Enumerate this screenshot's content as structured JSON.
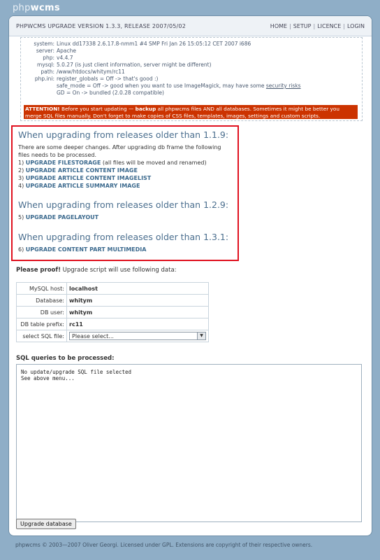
{
  "logo": {
    "light": "php",
    "bold": "wcms"
  },
  "header": {
    "title": "PHPWCMS UPGRADE VERSION 1.3.3, RELEASE 2007/05/02",
    "nav": [
      "HOME",
      "SETUP",
      "LICENCE",
      "LOGIN"
    ],
    "nav_separator": "|"
  },
  "system": {
    "rows": [
      {
        "key": "system:",
        "value": "Linux dd17338 2.6.17.8-nmm1 #4 SMP Fri Jan 26 15:05:12 CET 2007 i686"
      },
      {
        "key": "server:",
        "value": "Apache"
      },
      {
        "key": "php:",
        "value": "v4.4.7"
      },
      {
        "key": "mysql:",
        "value": "5.0.27 (is just client information, server might be different)"
      },
      {
        "key": "path:",
        "value": "/www/htdocs/whitym/rc11"
      },
      {
        "key": "php.ini:",
        "value": "register_globals = Off -> that's good :)"
      }
    ],
    "safe_mode_pre": "safe_mode = Off -> good when you want to use ImageMagick, may have some",
    "safe_mode_link": "security risks",
    "gd": "GD = On -> bundled (2.0.28 compatible)"
  },
  "attention": {
    "label": "ATTENTION!",
    "text1": " Before you start updating — ",
    "bold1": "backup",
    "text2": " all phpwcms files AND all databases. Sometimes it might be better you merge SQL files manually. Don't forget to make copies of CSS files, templates, images, settings and custom scripts."
  },
  "upgrade": {
    "h1": "When upgrading from releases older than 1.1.9:",
    "intro1": "There are some deeper changes. After upgrading db frame the following",
    "intro2": "files needs to be processed.",
    "items1": [
      {
        "num": "1)",
        "link": "UPGRADE FILESTORAGE",
        "note": " (all files will be moved and renamed)"
      },
      {
        "num": "2)",
        "link": "UPGRADE ARTICLE CONTENT IMAGE",
        "note": ""
      },
      {
        "num": "3)",
        "link": "UPGRADE ARTICLE CONTENT IMAGELIST",
        "note": ""
      },
      {
        "num": "4)",
        "link": "UPGRADE ARTICLE SUMMARY IMAGE",
        "note": ""
      }
    ],
    "h2": "When upgrading from releases older than 1.2.9:",
    "item5": {
      "num": "5)",
      "link": "UPGRADE PAGELAYOUT"
    },
    "h3": "When upgrading from releases older than 1.3.1:",
    "item6": {
      "num": "6)",
      "link": "UPGRADE CONTENT PART MULTIMEDIA"
    }
  },
  "proof": {
    "bold": "Please proof!",
    "rest": " Upgrade script will use following data:"
  },
  "db": {
    "host_label": "MySQL host:",
    "host": "localhost",
    "db_label": "Database:",
    "db": "whitym",
    "user_label": "DB user:",
    "user": "whitym",
    "prefix_label": "DB table prefix:",
    "prefix": "rc11",
    "sql_label": "select SQL file:",
    "sql_selected": "Please select..."
  },
  "sql": {
    "heading": "SQL queries to be processed:",
    "content": "No update/upgrade SQL file selected\nSee above menu..."
  },
  "button": {
    "label": "Upgrade database"
  },
  "footer": {
    "text": "phpwcms © 2003—2007 Oliver Georgi. Licensed under GPL. Extensions are copyright of their respective owners."
  },
  "colors": {
    "background": "#8faec7",
    "attention": "#cc3300",
    "highlight_border": "#e0101e",
    "link": "#3c6a8e"
  }
}
